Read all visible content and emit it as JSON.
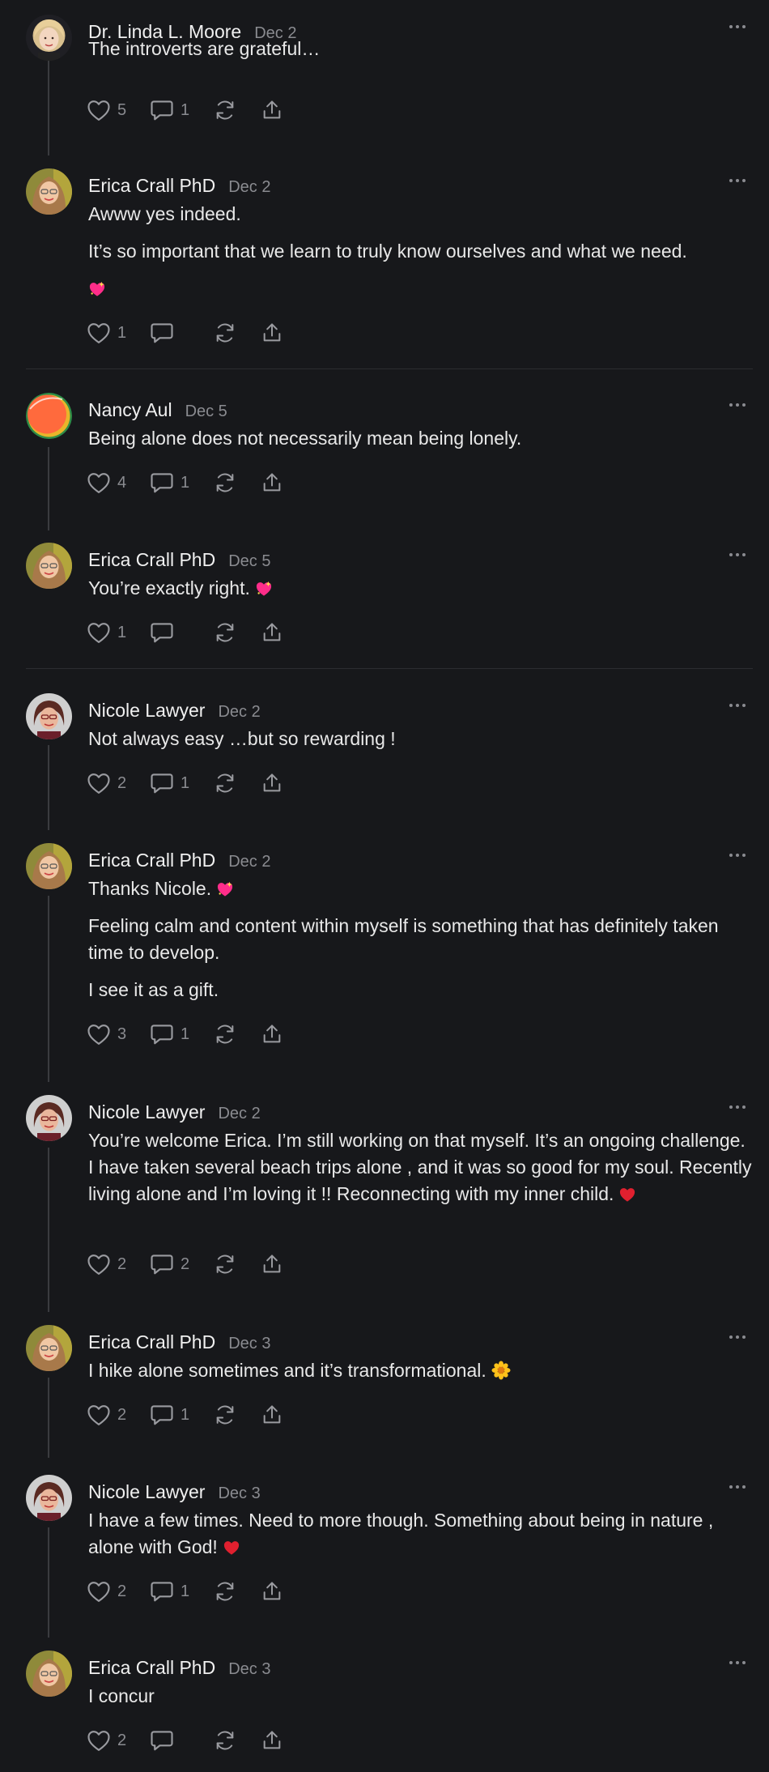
{
  "comments": [
    {
      "id": "c1",
      "author": "Dr. Linda L. Moore",
      "date": "Dec 2",
      "paragraphs": [
        "The introverts are grateful…"
      ],
      "likes": "5",
      "replies": "1",
      "avatar": "blonde"
    },
    {
      "id": "c2",
      "author": "Erica Crall PhD",
      "date": "Dec 2",
      "paragraphs": [
        "Awww yes indeed.",
        "It’s so important that we learn to truly know ourselves and what we need."
      ],
      "sparkle_heart_line": true,
      "likes": "1",
      "replies": "",
      "avatar": "erica"
    },
    {
      "id": "c3",
      "author": "Nancy Aul",
      "date": "Dec 5",
      "paragraphs": [
        "Being alone does not necessarily mean being lonely."
      ],
      "likes": "4",
      "replies": "1",
      "avatar": "orange"
    },
    {
      "id": "c4",
      "author": "Erica Crall PhD",
      "date": "Dec 5",
      "paragraphs": [
        "You’re exactly right."
      ],
      "likes": "1",
      "replies": "",
      "avatar": "erica"
    },
    {
      "id": "c5",
      "author": "Nicole Lawyer",
      "date": "Dec 2",
      "paragraphs": [
        "Not always easy …but so rewarding !"
      ],
      "likes": "2",
      "replies": "1",
      "avatar": "nicole"
    },
    {
      "id": "c6",
      "author": "Erica Crall PhD",
      "date": "Dec 2",
      "paragraphs": [
        "Thanks Nicole.",
        "Feeling calm and content within myself is something that has definitely taken time to develop.",
        "I see it as a gift."
      ],
      "likes": "3",
      "replies": "1",
      "avatar": "erica"
    },
    {
      "id": "c7",
      "author": "Nicole Lawyer",
      "date": "Dec 2",
      "paragraphs": [
        "You’re welcome Erica. I’m still working on that myself. It’s an ongoing challenge. I have taken several beach trips alone , and it was so good for my soul. Recently living alone and I’m loving it !! Reconnecting with my inner child."
      ],
      "likes": "2",
      "replies": "2",
      "avatar": "nicole"
    },
    {
      "id": "c8",
      "author": "Erica Crall PhD",
      "date": "Dec 3",
      "paragraphs": [
        "I hike alone sometimes and it’s transformational."
      ],
      "likes": "2",
      "replies": "1",
      "avatar": "erica"
    },
    {
      "id": "c9",
      "author": "Nicole Lawyer",
      "date": "Dec 3",
      "paragraphs": [
        "I have a few times. Need to more though. Something about being in nature , alone with God!"
      ],
      "likes": "2",
      "replies": "1",
      "avatar": "nicole"
    },
    {
      "id": "c10",
      "author": "Erica Crall PhD",
      "date": "Dec 3",
      "paragraphs": [
        "I concur"
      ],
      "likes": "2",
      "replies": "",
      "avatar": "erica"
    }
  ],
  "icons": {
    "like": "heart-icon",
    "reply": "comment-bubble-icon",
    "restack": "restack-icon",
    "share": "share-icon",
    "more": "more-options-icon"
  },
  "colors": {
    "background": "#17181b",
    "text": "#ebebeb",
    "muted": "#8a8b90",
    "thread_line": "#3a3b3f",
    "heart_emoji": "#ff2d8a"
  }
}
